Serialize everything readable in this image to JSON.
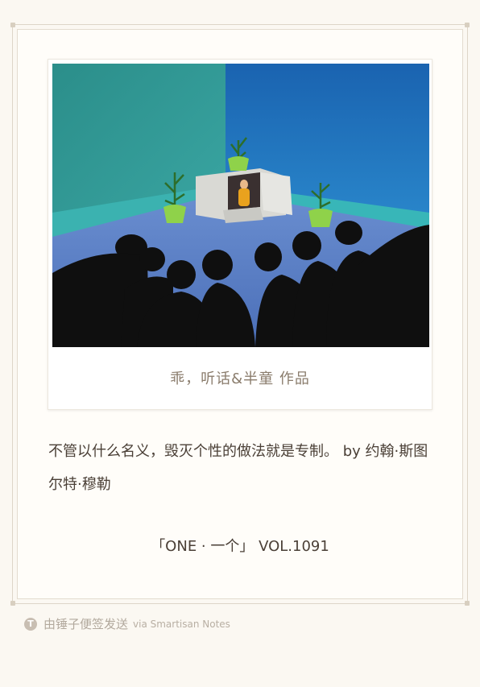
{
  "artwork": {
    "caption": "乖，听话&半童 作品",
    "colors": {
      "wall_left": "#2e9a9a",
      "wall_right": "#1f6fb8",
      "floor": "#5f87c8",
      "silhouettes": "#101010",
      "plants": "#8fd24a",
      "box": "#d8d8d4"
    }
  },
  "quote": {
    "text": "不管以什么名义，毁灭个性的做法就是专制。  by 约翰·斯图尔特·穆勒"
  },
  "volume": {
    "label": "「ONE · 一个」 VOL.1091"
  },
  "footer": {
    "badge_icon": "T",
    "text": "由锤子便签发送",
    "sub": "via Smartisan Notes"
  }
}
